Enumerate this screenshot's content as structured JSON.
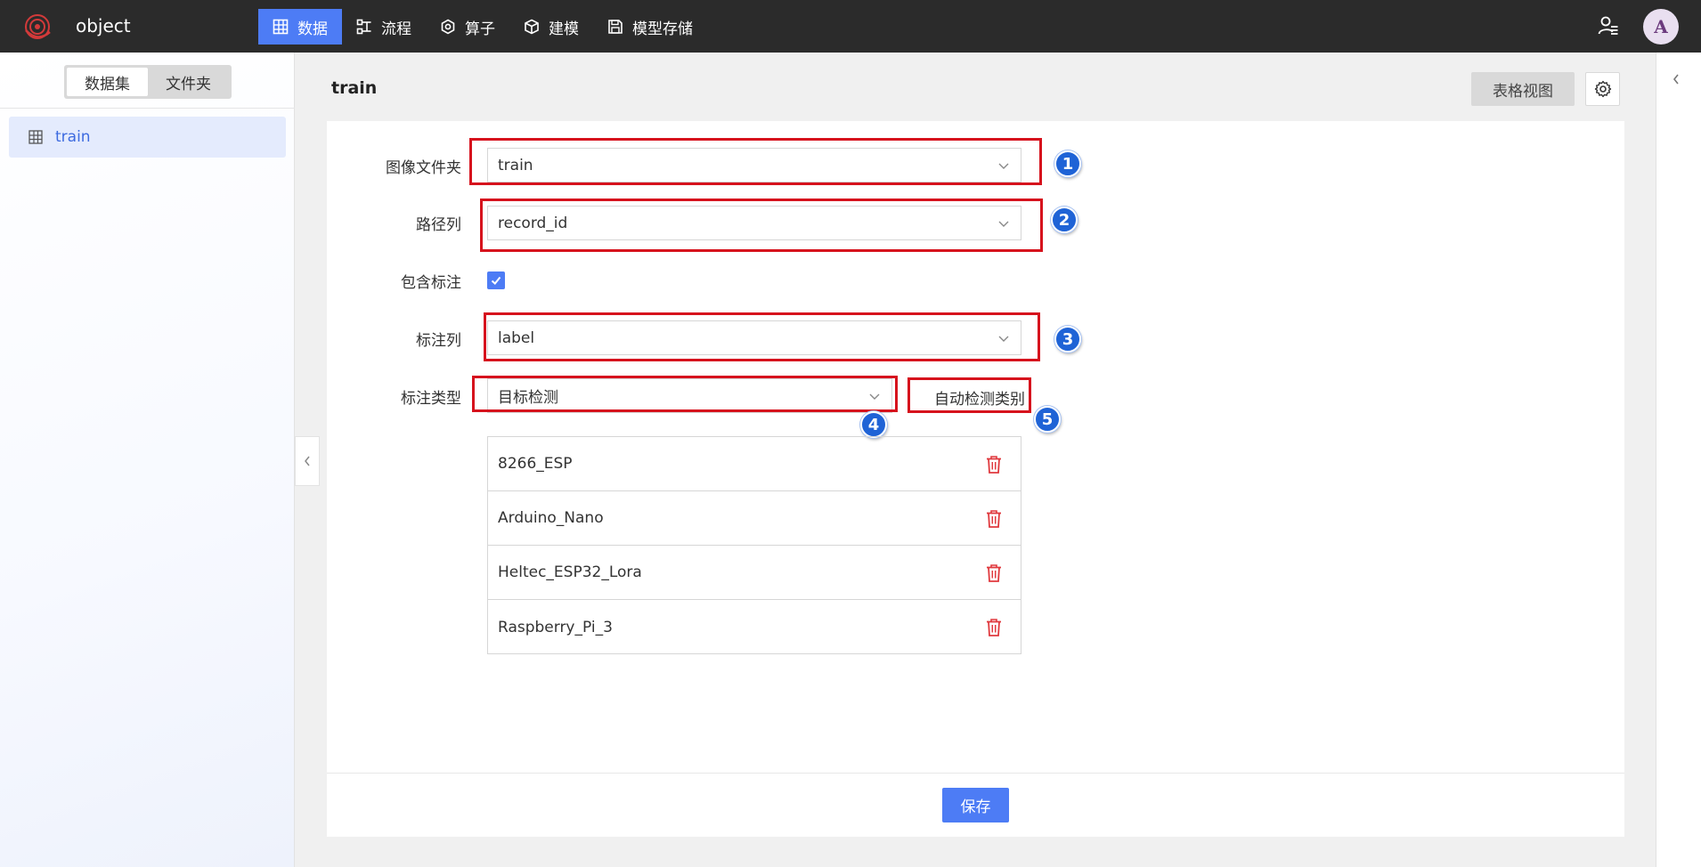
{
  "app": {
    "name": "object"
  },
  "nav": [
    {
      "label": "数据",
      "icon": "table-icon",
      "active": true
    },
    {
      "label": "流程",
      "icon": "flow-icon",
      "active": false
    },
    {
      "label": "算子",
      "icon": "hexagon-icon",
      "active": false
    },
    {
      "label": "建模",
      "icon": "cube-icon",
      "active": false
    },
    {
      "label": "模型存储",
      "icon": "save-icon",
      "active": false
    }
  ],
  "user": {
    "avatar_letter": "A"
  },
  "sidebar": {
    "tabs": [
      {
        "label": "数据集",
        "active": true
      },
      {
        "label": "文件夹",
        "active": false
      }
    ],
    "items": [
      {
        "label": "train",
        "icon": "table-icon"
      }
    ]
  },
  "header": {
    "title": "train",
    "table_view_label": "表格视图"
  },
  "form": {
    "image_folder": {
      "label": "图像文件夹",
      "value": "train"
    },
    "path_column": {
      "label": "路径列",
      "value": "record_id"
    },
    "has_annotation": {
      "label": "包含标注",
      "checked": true
    },
    "annotation_column": {
      "label": "标注列",
      "value": "label"
    },
    "annotation_type": {
      "label": "标注类型",
      "value": "目标检测"
    },
    "auto_detect_label": "自动检测类别",
    "classes": [
      "8266_ESP",
      "Arduino_Nano",
      "Heltec_ESP32_Lora",
      "Raspberry_Pi_3"
    ]
  },
  "badges": [
    "1",
    "2",
    "3",
    "4",
    "5"
  ],
  "footer": {
    "save_label": "保存"
  },
  "colors": {
    "accent": "#4d7cf5",
    "highlight": "#d6121d",
    "badge": "#1f63d6",
    "delete": "#e0393e"
  }
}
